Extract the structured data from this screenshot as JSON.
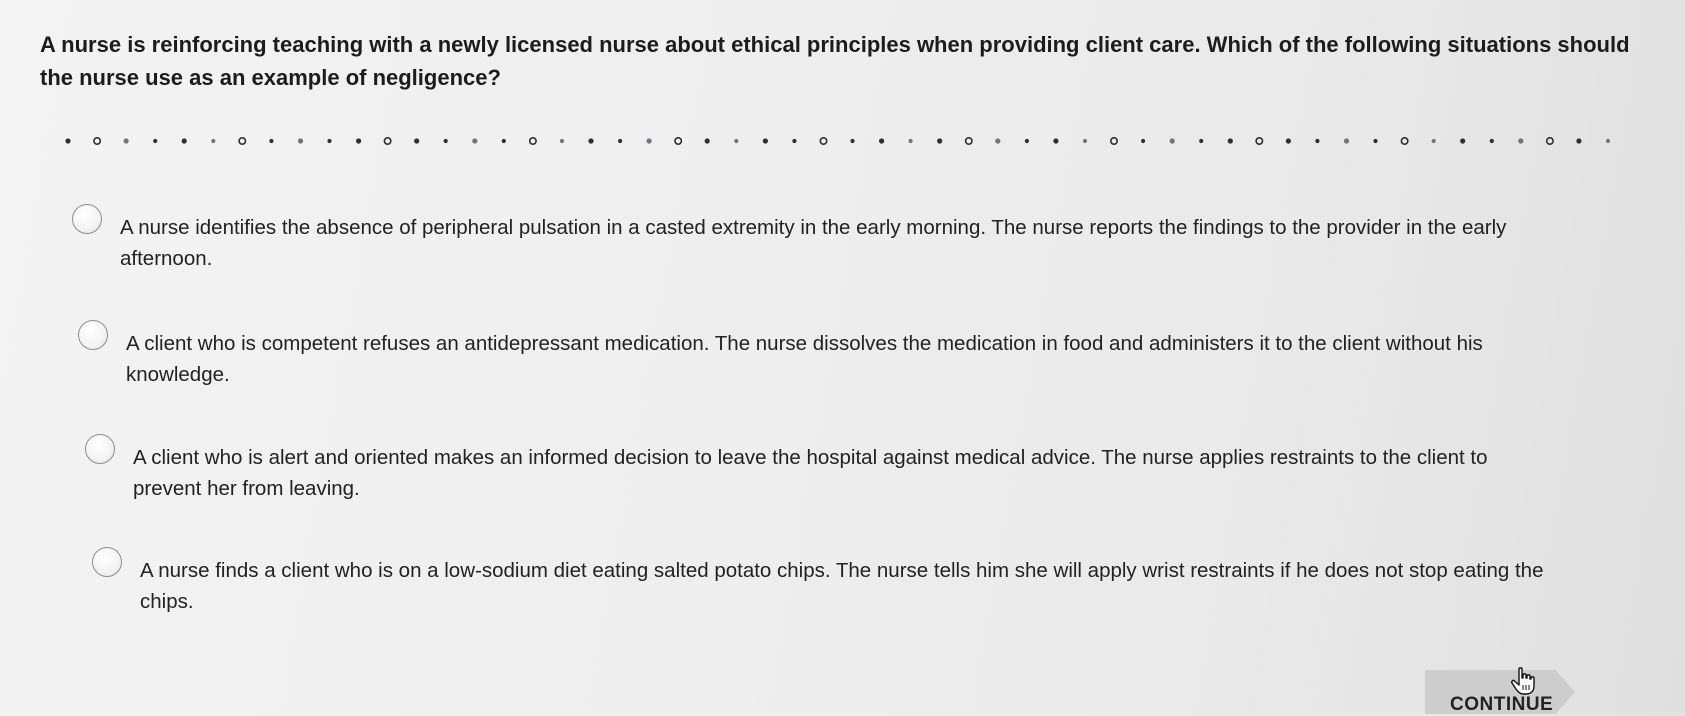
{
  "question": {
    "text": "A nurse is reinforcing teaching with a newly licensed nurse about ethical principles when providing client care. Which of the following situations should the nurse use as an example of negligence?"
  },
  "options": [
    {
      "text": "A nurse identifies the absence of peripheral pulsation in a casted extremity in the early morning. The nurse reports the findings to the provider in the early afternoon."
    },
    {
      "text": "A client who is competent refuses an antidepressant medication. The nurse dissolves the medication in food and administers it to the client without his knowledge."
    },
    {
      "text": "A client who is alert and oriented makes an informed decision to leave the hospital against medical advice. The nurse applies restraints to the client to prevent her from leaving."
    },
    {
      "text": "A nurse finds a client who is on a low-sodium diet eating salted potato chips. The nurse tells him she will apply wrist restraints if he does not stop eating the chips."
    }
  ],
  "continue_button": {
    "label": "CONTINUE"
  },
  "icons": {
    "radio": "radio-unselected-icon",
    "cursor": "hand-pointer-icon"
  },
  "colors": {
    "background": "#eeeeee",
    "button": "#cdcdcd",
    "text": "#1f1f1f"
  }
}
